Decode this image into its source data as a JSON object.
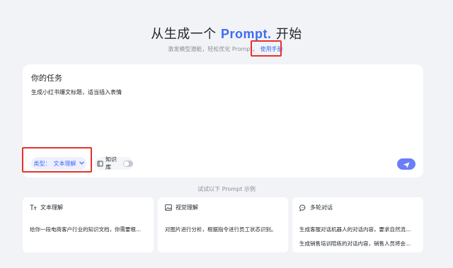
{
  "header": {
    "title_prefix": "从生成一个 ",
    "title_brand": "Prompt.",
    "title_suffix": " 开始",
    "subtitle": "激发模型潜能，轻松优化 Prompt。",
    "manual_link": "使用手册"
  },
  "task": {
    "title": "你的任务",
    "text": "生成小红书爆文标题，适当插入表情",
    "type_label": "类型：",
    "type_value": "文本理解",
    "knowledge_label": "知识库",
    "knowledge_enabled": false
  },
  "examples": {
    "caption": "试试以下 Prompt 示例",
    "cards": [
      {
        "icon": "text-format-icon",
        "title": "文本理解",
        "lines": [
          "给你一段电商客户行业的知识文档，你需要根..."
        ]
      },
      {
        "icon": "image-icon",
        "title": "视觉理解",
        "lines": [
          "对图片进行分析，根据指令进行员工状态识别。"
        ]
      },
      {
        "icon": "chat-bubble-icon",
        "title": "多轮对话",
        "lines": [
          "生成客服对话机器人的对话内容，要求自然流...",
          "生成销售培训陪练的对话内容，销售人员将会..."
        ]
      }
    ]
  },
  "colors": {
    "accent": "#3d6cf5",
    "send_button": "#6b7ef7",
    "highlight": "#e5332a",
    "background": "#f2f3f7"
  }
}
